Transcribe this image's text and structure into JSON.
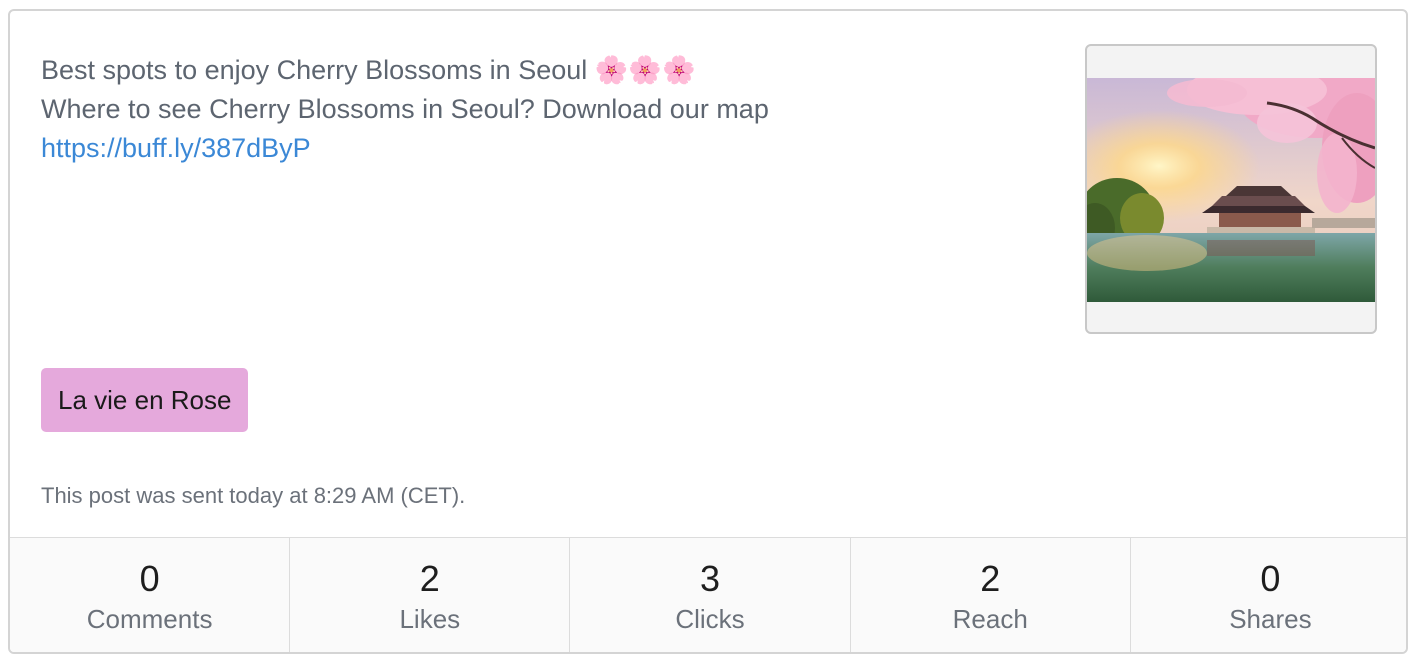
{
  "post": {
    "line1": "Best spots to enjoy Cherry Blossoms in Seoul 🌸🌸🌸",
    "line2": "Where to see Cherry Blossoms in Seoul? Download our map",
    "link": "https://buff.ly/387dByP",
    "image_icon": "cherry-blossom-pavilion-photo"
  },
  "tag": {
    "label": "La vie en Rose",
    "color": "#e5a9dc"
  },
  "sent_info": "This post was sent today at 8:29 AM (CET).",
  "stats": [
    {
      "value": "0",
      "label": "Comments"
    },
    {
      "value": "2",
      "label": "Likes"
    },
    {
      "value": "3",
      "label": "Clicks"
    },
    {
      "value": "2",
      "label": "Reach"
    },
    {
      "value": "0",
      "label": "Shares"
    }
  ],
  "colors": {
    "link": "#3b88d6",
    "text": "#5d6570",
    "border": "#d4d4d4"
  }
}
